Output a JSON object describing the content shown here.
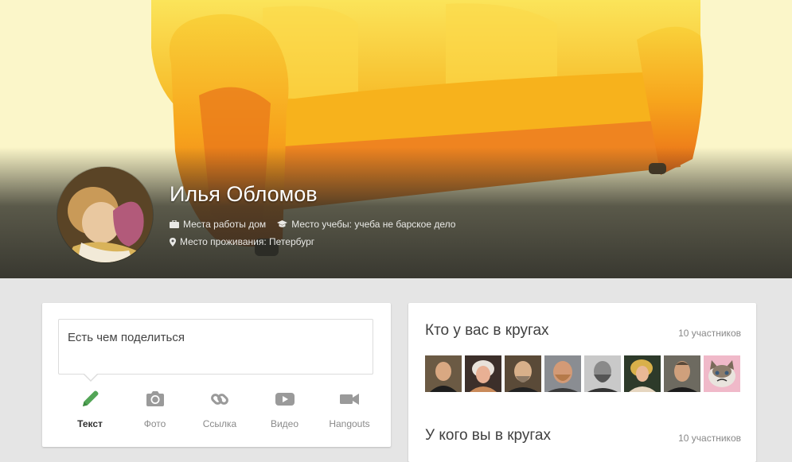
{
  "profile": {
    "name": "Илья Обломов",
    "work": "Места работы дом",
    "education": "Место учебы: учеба не барское дело",
    "residence": "Место проживания: Петербург"
  },
  "share": {
    "placeholder": "Есть чем поделиться",
    "actions": [
      {
        "label": "Текст",
        "icon": "pencil-icon",
        "active": true
      },
      {
        "label": "Фото",
        "icon": "camera-icon",
        "active": false
      },
      {
        "label": "Ссылка",
        "icon": "link-icon",
        "active": false
      },
      {
        "label": "Видео",
        "icon": "video-play-icon",
        "active": false
      },
      {
        "label": "Hangouts",
        "icon": "hangouts-camera-icon",
        "active": false
      }
    ]
  },
  "circles": {
    "in_your_circles": {
      "title": "Кто у вас в кругах",
      "count": "10 участников"
    },
    "have_you_in_circles": {
      "title": "У кого вы в кругах",
      "count": "10 участников"
    }
  },
  "colors": {
    "accent_green": "#52a556",
    "cover_bg": "#fbf6c9",
    "sofa": "#f7b21c"
  }
}
